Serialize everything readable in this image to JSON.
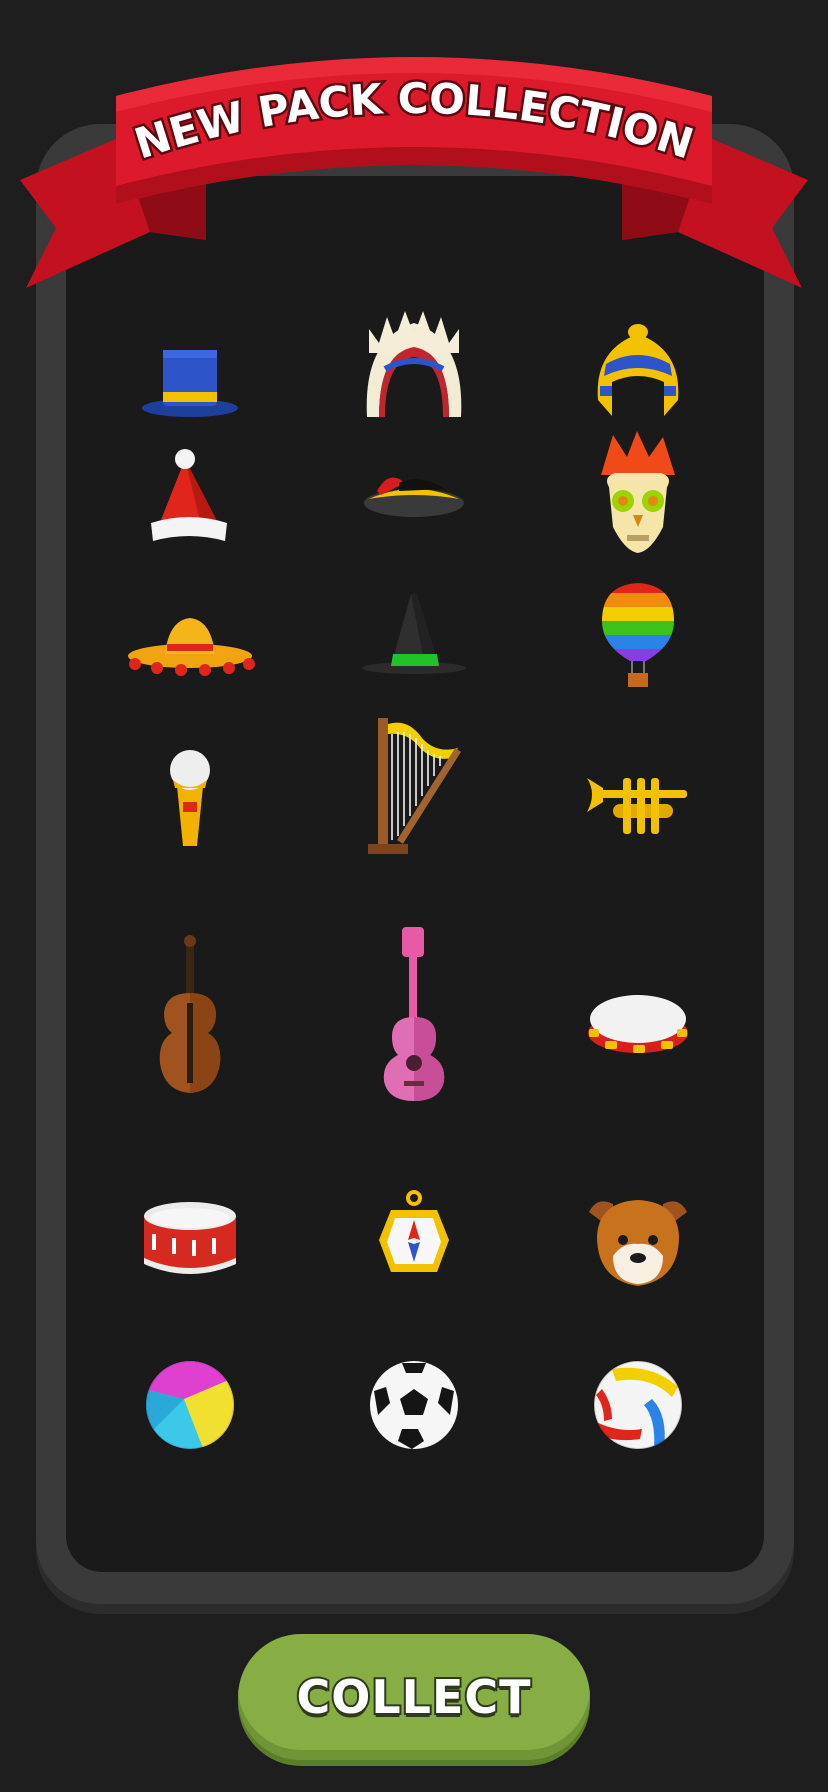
{
  "header": {
    "title": "NEW PACK COLLECTION"
  },
  "colors": {
    "background": "#1e1e1e",
    "panel": "#3a3a3a",
    "ribbon": "#d8192a",
    "button": "#86ae45"
  },
  "items": [
    {
      "name": "top-hat-icon"
    },
    {
      "name": "feather-headdress-icon"
    },
    {
      "name": "pharaoh-headdress-icon"
    },
    {
      "name": "santa-hat-icon"
    },
    {
      "name": "captain-hat-icon"
    },
    {
      "name": "skull-mask-icon"
    },
    {
      "name": "sombrero-icon"
    },
    {
      "name": "witch-hat-icon"
    },
    {
      "name": "hot-air-balloon-icon"
    },
    {
      "name": "microphone-icon"
    },
    {
      "name": "harp-icon"
    },
    {
      "name": "trumpet-icon"
    },
    {
      "name": "violin-icon"
    },
    {
      "name": "ukulele-icon"
    },
    {
      "name": "tambourine-icon"
    },
    {
      "name": "drum-icon"
    },
    {
      "name": "compass-icon"
    },
    {
      "name": "dog-head-icon"
    },
    {
      "name": "beach-ball-icon"
    },
    {
      "name": "soccer-ball-icon"
    },
    {
      "name": "volleyball-icon"
    }
  ],
  "actions": {
    "collect_label": "COLLECT"
  }
}
